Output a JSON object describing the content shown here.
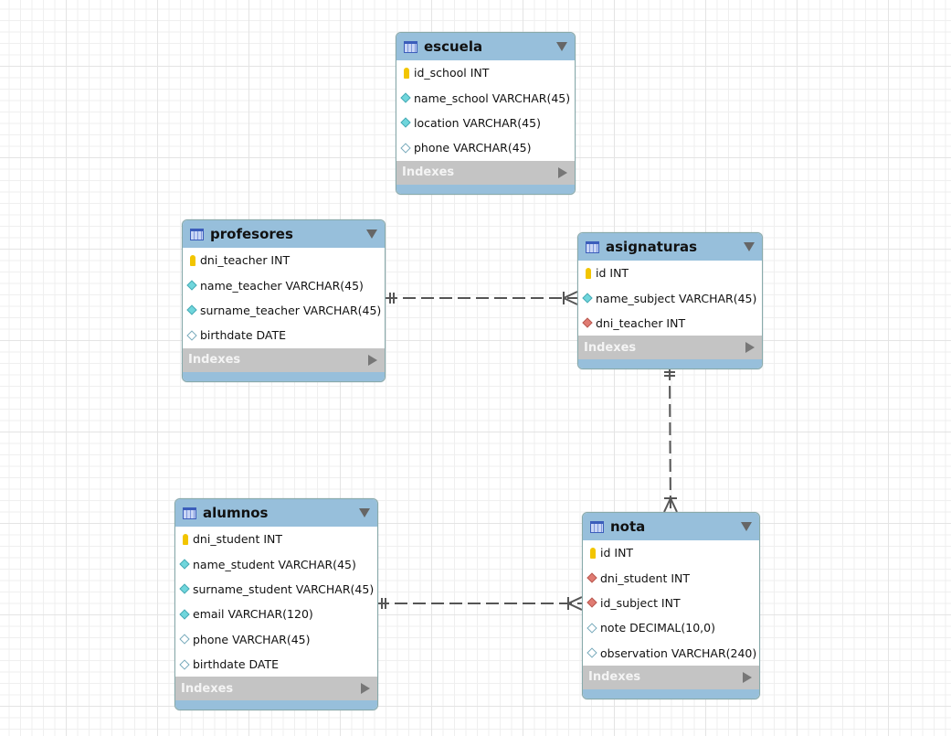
{
  "indexes_label": "Indexes",
  "tables": [
    {
      "name": "escuela",
      "columns": [
        {
          "text": "id_school INT",
          "kind": "pk"
        },
        {
          "text": "name_school VARCHAR(45)",
          "kind": "nn"
        },
        {
          "text": "location VARCHAR(45)",
          "kind": "nn"
        },
        {
          "text": "phone VARCHAR(45)",
          "kind": "nl"
        }
      ]
    },
    {
      "name": "profesores",
      "columns": [
        {
          "text": "dni_teacher INT",
          "kind": "pk"
        },
        {
          "text": "name_teacher VARCHAR(45)",
          "kind": "nn"
        },
        {
          "text": "surname_teacher VARCHAR(45)",
          "kind": "nn"
        },
        {
          "text": "birthdate DATE",
          "kind": "nl"
        }
      ]
    },
    {
      "name": "asignaturas",
      "columns": [
        {
          "text": "id INT",
          "kind": "pk"
        },
        {
          "text": "name_subject VARCHAR(45)",
          "kind": "nn"
        },
        {
          "text": "dni_teacher INT",
          "kind": "fk"
        }
      ]
    },
    {
      "name": "alumnos",
      "columns": [
        {
          "text": "dni_student INT",
          "kind": "pk"
        },
        {
          "text": "name_student VARCHAR(45)",
          "kind": "nn"
        },
        {
          "text": "surname_student VARCHAR(45)",
          "kind": "nn"
        },
        {
          "text": "email VARCHAR(120)",
          "kind": "nn"
        },
        {
          "text": "phone VARCHAR(45)",
          "kind": "nl"
        },
        {
          "text": "birthdate DATE",
          "kind": "nl"
        }
      ]
    },
    {
      "name": "nota",
      "columns": [
        {
          "text": "id INT",
          "kind": "pk"
        },
        {
          "text": "dni_student INT",
          "kind": "fk"
        },
        {
          "text": "id_subject INT",
          "kind": "fk"
        },
        {
          "text": "note DECIMAL(10,0)",
          "kind": "nl"
        },
        {
          "text": "observation VARCHAR(240)",
          "kind": "nl"
        }
      ]
    }
  ],
  "relationships": [
    {
      "from": "profesores",
      "to": "asignaturas",
      "type": "one-to-many"
    },
    {
      "from": "asignaturas",
      "to": "nota",
      "type": "one-to-many"
    },
    {
      "from": "alumnos",
      "to": "nota",
      "type": "one-to-many"
    }
  ]
}
